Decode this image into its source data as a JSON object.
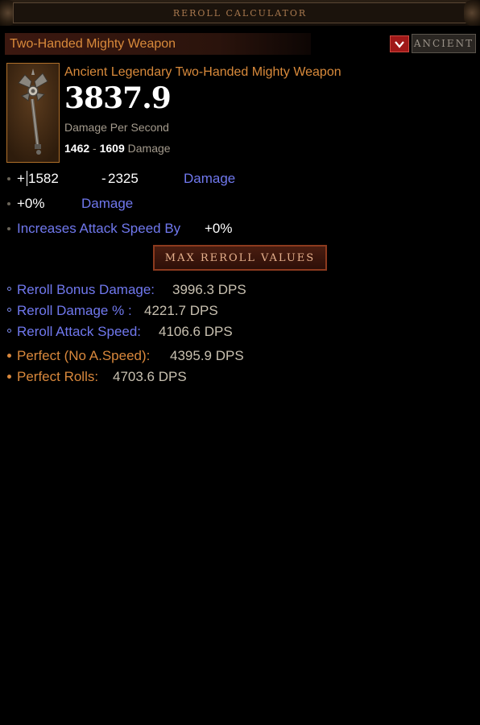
{
  "window": {
    "title": "REROLL CALCULATOR"
  },
  "item": {
    "slot_name": "Two-Handed Mighty Weapon",
    "ancient_label": "ANCIENT",
    "ancient_checked": true,
    "full_name": "Ancient Legendary Two-Handed Mighty Weapon",
    "dps": "3837.9",
    "dps_label": "Damage Per Second",
    "damage_min": "1462",
    "damage_sep": "-",
    "damage_max": "1609",
    "damage_label": "Damage",
    "icon": "axe-icon"
  },
  "stats": {
    "bonus_min": "1582",
    "bonus_plus": "+",
    "bonus_max_prefix": "-",
    "bonus_max": "2325",
    "bonus_label": "Damage",
    "pct_value": "+0%",
    "pct_label": "Damage",
    "ias_label": "Increases Attack Speed By",
    "ias_value": "+0%"
  },
  "max_button": {
    "label": "MAX REROLL VALUES"
  },
  "results": [
    {
      "label": "Reroll Bonus Damage:",
      "value": "3996.3 DPS",
      "kind": "blue"
    },
    {
      "label": "Reroll Damage % :",
      "value": "4221.7 DPS",
      "kind": "blue"
    },
    {
      "label": "Reroll Attack Speed:",
      "value": "4106.6 DPS",
      "kind": "blue"
    },
    {
      "label": "Perfect (No A.Speed):",
      "value": "4395.9 DPS",
      "kind": "orange"
    },
    {
      "label": "Perfect Rolls:",
      "value": "4703.6 DPS",
      "kind": "orange"
    }
  ],
  "colors": {
    "legendary": "#d98a3b",
    "magic": "#7078ee",
    "ancient_toggle": "#a01818"
  }
}
